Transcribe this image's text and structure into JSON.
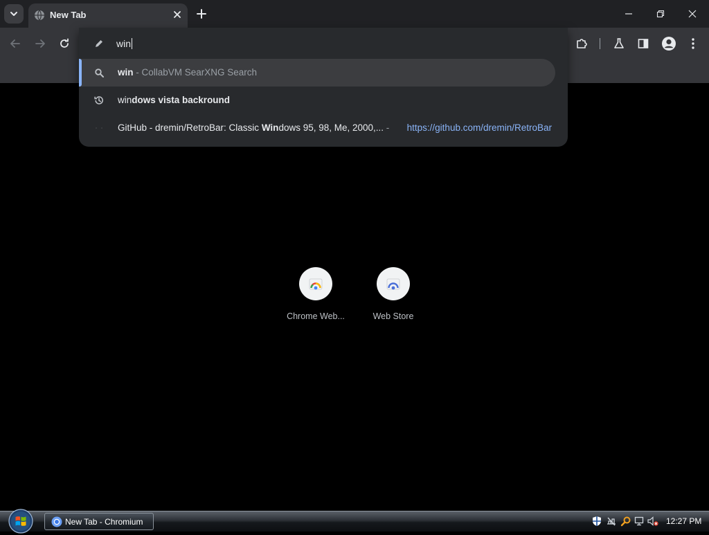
{
  "browser": {
    "tab": {
      "title": "New Tab"
    }
  },
  "omnibox": {
    "input_value": "win",
    "suggestions": [
      {
        "segments": [
          {
            "text": "win",
            "bold": true
          },
          {
            "text": " - CollabVM SearXNG Search",
            "bold": false,
            "dim": true
          }
        ],
        "icon": "search-icon",
        "selected": true
      },
      {
        "segments": [
          {
            "text": "win",
            "bold": false
          },
          {
            "text": "dows vista backround",
            "bold": true
          }
        ],
        "icon": "history-icon",
        "selected": false
      },
      {
        "segments": [
          {
            "text": "GitHub - dremin/RetroBar: Classic ",
            "bold": false
          },
          {
            "text": "Win",
            "bold": true
          },
          {
            "text": "dows 95, 98, Me, 2000,...",
            "bold": false
          },
          {
            "text": " - ",
            "bold": false,
            "dim": true
          }
        ],
        "url": "https://github.com/dremin/RetroBar",
        "icon": "page-icon",
        "selected": false
      }
    ]
  },
  "shortcuts": [
    {
      "label": "Chrome Web...",
      "icon": "chrome-web-store-icon"
    },
    {
      "label": "Web Store",
      "icon": "web-store-icon"
    }
  ],
  "taskbar": {
    "task_button": "New Tab - Chromium",
    "clock": "12:27 PM"
  },
  "colors": {
    "tab_strip": "#202124",
    "toolbar": "#35363a",
    "dropdown": "#282a2d",
    "selected_row": "#3c3d40",
    "accent": "#8ab4f8",
    "link": "#8ab4f8",
    "page_background": "#000000"
  }
}
